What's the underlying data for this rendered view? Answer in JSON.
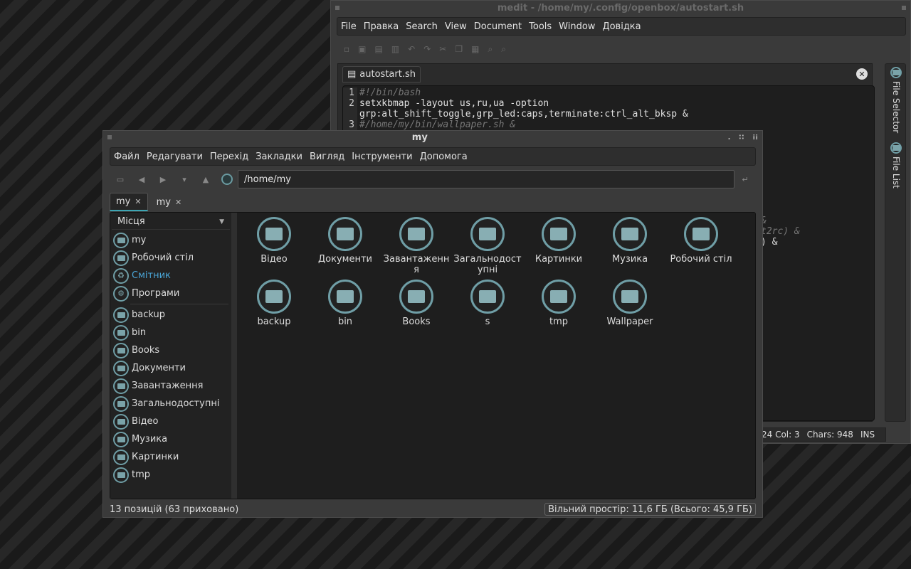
{
  "medit": {
    "title": "medit - /home/my/.config/openbox/autostart.sh",
    "menu": [
      "File",
      "Правка",
      "Search",
      "View",
      "Document",
      "Tools",
      "Window",
      "Довідка"
    ],
    "tab_label": "autostart.sh",
    "code_lines": [
      {
        "n": "1",
        "text": "#!/bin/bash",
        "style": "cm"
      },
      {
        "n": "2",
        "text": "setxkbmap -layout us,ru,ua -option",
        "style": ""
      },
      {
        "n": "",
        "text": "grp:alt_shift_toggle,grp_led:caps,terminate:ctrl_alt_bksp &",
        "style": ""
      },
      {
        "n": "3",
        "text": "#/home/my/bin/wallpaper.sh &",
        "style": "cm"
      }
    ],
    "ghost_fragments": [
      "&",
      "t2rc) &",
      ") &"
    ],
    "side_tabs": [
      "File Selector",
      "File List"
    ],
    "status": {
      "pos": "24 Col: 3",
      "chars": "Chars: 948",
      "mode": "INS"
    }
  },
  "fm": {
    "title": "my",
    "menu": [
      "Файл",
      "Редагувати",
      "Перехід",
      "Закладки",
      "Вигляд",
      "Інструменти",
      "Допомога"
    ],
    "path": "/home/my",
    "tabs": [
      "my",
      "my"
    ],
    "sidebar_header": "Місця",
    "places": [
      "my",
      "Робочий стіл",
      "Смітник",
      "Програми"
    ],
    "bookmarks": [
      "backup",
      "bin",
      "Books",
      "Документи",
      "Завантаження",
      "Загальнодоступні",
      "Відео",
      "Музика",
      "Картинки",
      "tmp"
    ],
    "items": [
      "Відео",
      "Документи",
      "Завантаження",
      "Загальнодоступні",
      "Картинки",
      "Музика",
      "Робочий стіл",
      "backup",
      "bin",
      "Books",
      "s",
      "tmp",
      "Wallpaper"
    ],
    "status_left": "13 позицій (63 приховано)",
    "status_right": "Вільний простір: 11,6 ГБ (Всього: 45,9 ГБ)"
  },
  "colors": {
    "accent": "#3da5b3",
    "folder": "#6f9ea6",
    "link": "#4aa5d6"
  }
}
